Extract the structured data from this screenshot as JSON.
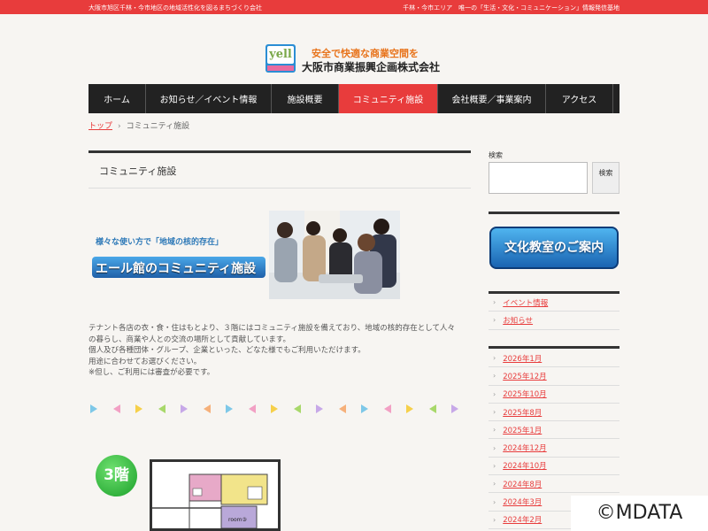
{
  "topbar": {
    "left": "大阪市旭区千林・今市地区の地域活性化を図るまちづくり会社",
    "right": "千林・今市エリア　唯一の「生活・文化・コミュニケーション」情報発信基地"
  },
  "logo": {
    "badge_text": "yell",
    "tagline": "安全で快適な商業空間を",
    "company": "大阪市商業振興企画株式会社"
  },
  "nav": {
    "items": [
      {
        "label": "ホーム"
      },
      {
        "label": "お知らせ／イベント情報"
      },
      {
        "label": "施設概要"
      },
      {
        "label": "コミュニティ施設"
      },
      {
        "label": "会社概要／事業案内"
      },
      {
        "label": "アクセス"
      }
    ]
  },
  "breadcrumb": {
    "home": "トップ",
    "separator": "›",
    "current": "コミュニティ施設"
  },
  "page_title": "コミュニティ施設",
  "banner": {
    "catch": "様々な使い方で「地域の核的存在」",
    "title": "エール館のコミュニティ施設"
  },
  "description": {
    "line1": "テナント各店の衣・食・住はもとより、３階にはコミュニティ施設を備えており、地域の核的存在として人々",
    "line2": "の暮らし、商業や人との交流の場所として貢献しています。",
    "line3": "個人及び各種団体・グループ、企業といった、どなた様でもご利用いただけます。",
    "line4": "用途に合わせてお選びください。",
    "line5": "※但し、ご利用には審査が必要です。"
  },
  "floor": {
    "badge": "3階",
    "room_label": "room③"
  },
  "sidebar": {
    "search_label": "検索",
    "search_button": "検索",
    "culture_button": "文化教室のご案内",
    "category_links": [
      {
        "label": "イベント情報"
      },
      {
        "label": "お知らせ"
      }
    ],
    "archive_links": [
      {
        "label": "2026年1月"
      },
      {
        "label": "2025年12月"
      },
      {
        "label": "2025年10月"
      },
      {
        "label": "2025年8月"
      },
      {
        "label": "2025年1月"
      },
      {
        "label": "2024年12月"
      },
      {
        "label": "2024年10月"
      },
      {
        "label": "2024年8月"
      },
      {
        "label": "2024年3月"
      },
      {
        "label": "2024年2月"
      }
    ]
  },
  "watermark": "©MDATA",
  "colors": {
    "accent": "#e83c3c",
    "nav_bg": "#222222",
    "link": "#e83c3c"
  }
}
